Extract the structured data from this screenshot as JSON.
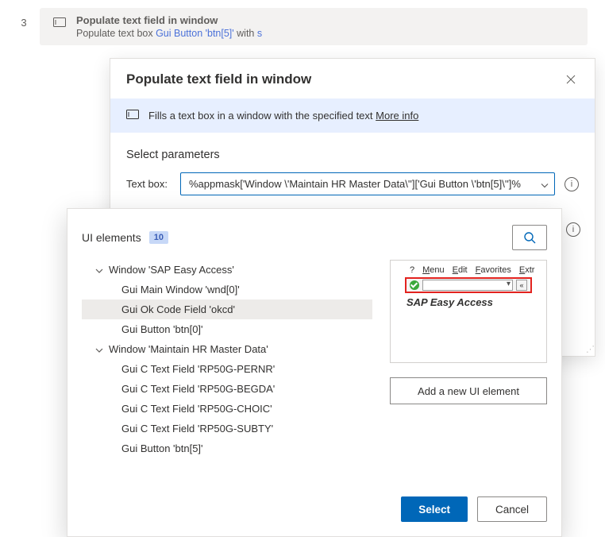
{
  "step": {
    "number": "3",
    "title": "Populate text field in window",
    "desc_prefix": "Populate text box ",
    "desc_link": "Gui Button 'btn[5]'",
    "desc_mid": " with ",
    "desc_suffix": "s"
  },
  "dialog": {
    "title": "Populate text field in window",
    "info_text": "Fills a text box in a window with the specified text ",
    "info_more": "More info",
    "params_heading": "Select parameters",
    "textbox_label": "Text box:",
    "textbox_value": "%appmask['Window \\'Maintain HR Master Data\\'']['Gui Button \\'btn[5]\\'']%"
  },
  "popover": {
    "title": "UI elements",
    "count": "10",
    "tree": {
      "window1": "Window 'SAP Easy Access'",
      "w1_items": {
        "i0": "Gui Main Window 'wnd[0]'",
        "i1": "Gui Ok Code Field 'okcd'",
        "i2": "Gui Button 'btn[0]'"
      },
      "window2": "Window 'Maintain HR Master Data'",
      "w2_items": {
        "i0": "Gui C Text Field 'RP50G-PERNR'",
        "i1": "Gui C Text Field 'RP50G-BEGDA'",
        "i2": "Gui C Text Field 'RP50G-CHOIC'",
        "i3": "Gui C Text Field 'RP50G-SUBTY'",
        "i4": "Gui Button 'btn[5]'"
      }
    },
    "preview": {
      "menu": {
        "m1": "Menu",
        "m2": "Edit",
        "m3": "Favorites",
        "m4": "Extr"
      },
      "back": "«",
      "title": "SAP Easy Access"
    },
    "add_button": "Add a new UI element",
    "select": "Select",
    "cancel": "Cancel"
  }
}
